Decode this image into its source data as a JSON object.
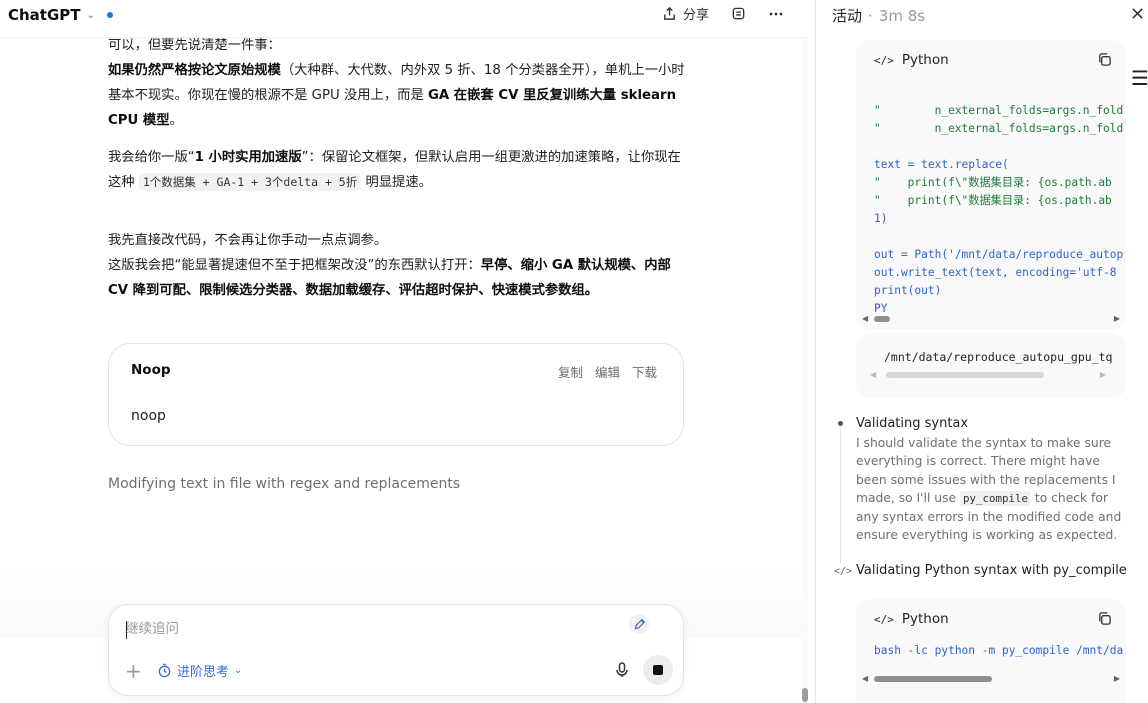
{
  "header": {
    "brand": "ChatGPT",
    "share_label": "分享"
  },
  "conversation": {
    "para1": {
      "line1": "可以，但要先说清楚一件事：",
      "bold_a": "如果仍然严格按论文原始规模",
      "text_a": "（大种群、大代数、内外双 5 折、18 个分类器全开），单机上一小时基本不现实。你现在慢的根源不是 GPU 没用上，而是 ",
      "bold_b": "GA 在嵌套 CV 里反复训练大量 sklearn CPU 模型",
      "text_b": "。"
    },
    "para2": {
      "text_a": "我会给你一版“",
      "bold_a": "1 小时实用加速版",
      "text_b": "”：保留论文框架，但默认启用一组更激进的加速策略，让你现在这种 ",
      "code": "1个数据集 + GA-1 + 3个delta + 5折",
      "text_c": " 明显提速。"
    },
    "para3": {
      "line1": "我先直接改代码，不会再让你手动一点点调参。",
      "text_a": "这版我会把“能显著提速但不至于把框架改没”的东西默认打开：",
      "bold_a": "早停、缩小 GA 默认规模、内部 CV 降到可配、限制候选分类器、数据加载缓存、评估超时保护、快速模式参数组。"
    },
    "card": {
      "title": "Noop",
      "copy": "复制",
      "edit": "编辑",
      "download": "下载",
      "body": "noop"
    },
    "status": "Modifying text in file with regex and replacements"
  },
  "composer": {
    "placeholder": "继续追问",
    "think_label": "进阶思考"
  },
  "panel": {
    "title": "活动",
    "separator": "·",
    "duration": "3m 8s",
    "code1": {
      "lang": "Python",
      "lines": [
        "\"        n_external_folds=args.n_fold",
        "\"        n_external_folds=args.n_fold",
        "",
        "text = text.replace(",
        "\"    print(f\\\"数据集目录: {os.path.ab",
        "\"    print(f\\\"数据集目录: {os.path.ab",
        "1)",
        "",
        "out = Path('/mnt/data/reproduce_autop",
        "out.write_text(text, encoding='utf-8",
        "print(out)",
        "PY"
      ]
    },
    "output1": "/mnt/data/reproduce_autopu_gpu_tq",
    "step1": {
      "title": "Validating syntax",
      "body_a": "I should validate the syntax to make sure everything is correct. There might have been some issues with the replacements I made, so I'll use ",
      "body_code": "py_compile",
      "body_b": " to check for any syntax errors in the modified code and ensure everything is working as expected."
    },
    "step2": {
      "title": "Validating Python syntax with py_compile"
    },
    "code2": {
      "lang": "Python",
      "line": "bash -lc python -m py_compile /mnt/da"
    }
  }
}
